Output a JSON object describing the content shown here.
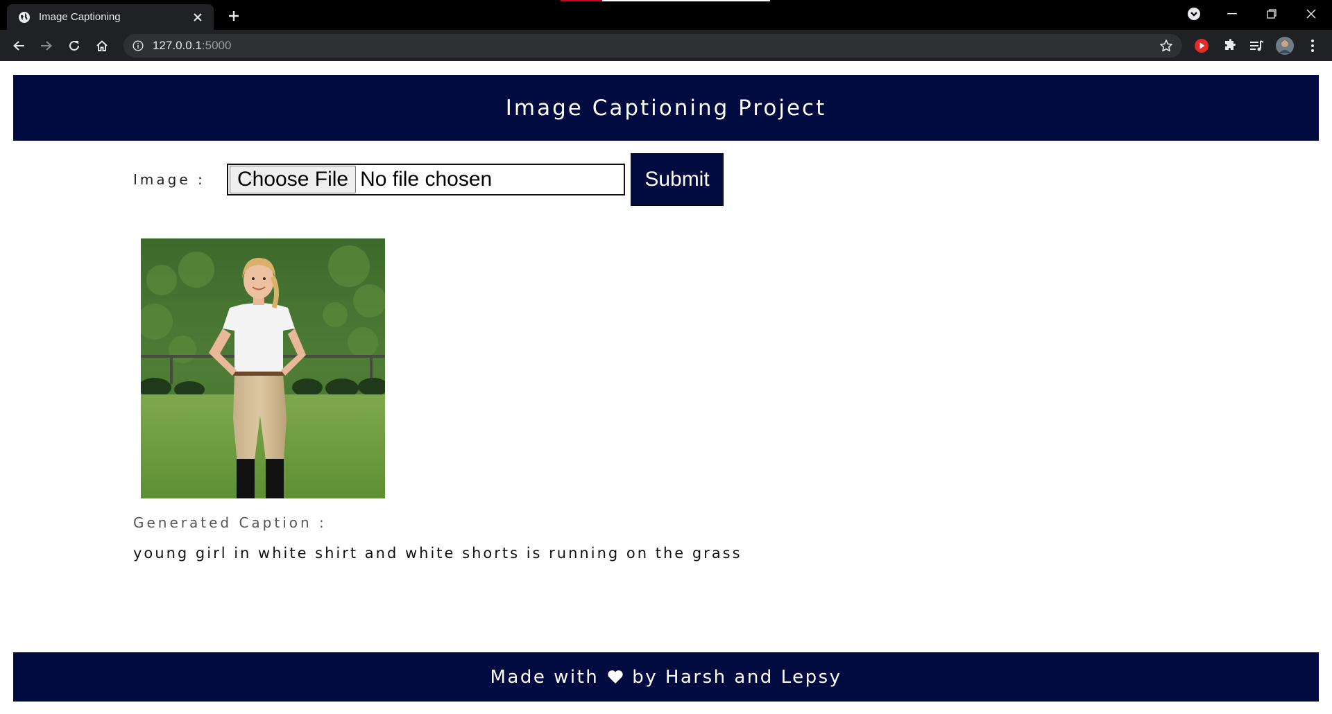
{
  "browser": {
    "tab_title": "Image Captioning",
    "url_host": "127.0.0.1",
    "url_port": ":5000"
  },
  "header": {
    "title": "Image Captioning Project"
  },
  "form": {
    "image_label": "Image :",
    "choose_file_label": "Choose File",
    "file_status": "No file chosen",
    "submit_label": "Submit"
  },
  "result": {
    "caption_label": "Generated Caption :",
    "caption_text": "young girl in white shirt and white shorts is running on the grass"
  },
  "footer": {
    "text_before": "Made with",
    "text_after": "by Harsh and Lepsy"
  },
  "colors": {
    "navy": "#010b40",
    "chrome_dark": "#202124",
    "titlebar": "#000000"
  },
  "icons": [
    "globe-icon",
    "close-icon",
    "plus-icon",
    "back-icon",
    "forward-icon",
    "reload-icon",
    "home-icon",
    "info-icon",
    "star-icon",
    "heart-icon"
  ]
}
